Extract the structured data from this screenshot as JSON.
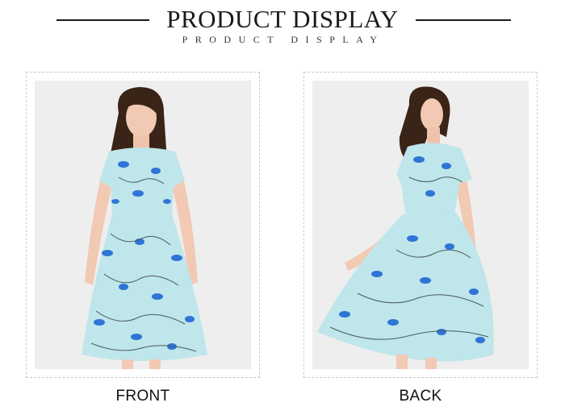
{
  "header": {
    "title": "PRODUCT DISPLAY",
    "subtitle": "PRODUCT DISPLAY"
  },
  "views": [
    {
      "label": "FRONT"
    },
    {
      "label": "BACK"
    }
  ],
  "colors": {
    "dress": "#bfe6ea",
    "flower": "#2f74d6",
    "hair": "#3a2418",
    "skin": "#f2c9b3",
    "backdrop": "#eeeeee"
  }
}
